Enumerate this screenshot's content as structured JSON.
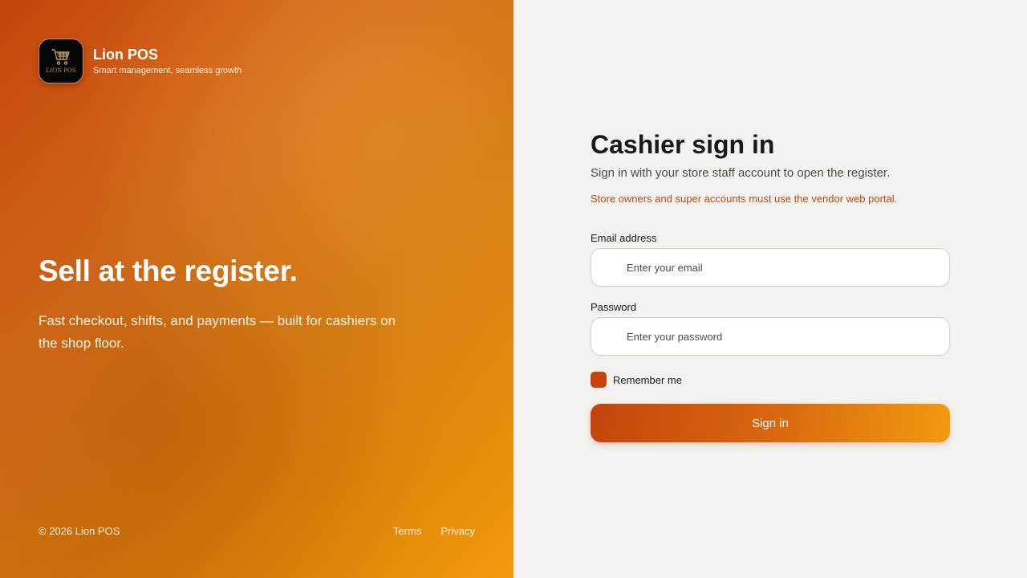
{
  "brand": {
    "name": "Lion POS",
    "tagline": "Smart management, seamless growth",
    "logo_text": "LION POS",
    "logo_icon": "shopping-cart-icon"
  },
  "hero": {
    "title": "Sell at the register.",
    "subtitle": "Fast checkout, shifts, and payments — built for cashiers on the shop floor."
  },
  "footer": {
    "copyright": "© 2026 Lion POS",
    "links": [
      "Terms",
      "Privacy"
    ]
  },
  "signin": {
    "title": "Cashier sign in",
    "subtitle": "Sign in with your store staff account to open the register.",
    "note": "Store owners and super accounts must use the vendor web portal.",
    "email": {
      "label": "Email address",
      "placeholder": "Enter your email",
      "value": "",
      "icon": "mail-icon"
    },
    "password": {
      "label": "Password",
      "placeholder": "Enter your password",
      "value": "",
      "icon": "lock-icon"
    },
    "remember_label": "Remember me",
    "remember_checked": true,
    "button_label": "Sign in"
  },
  "colors": {
    "accent": "#c4440c",
    "accent_end": "#f39a10",
    "note": "#bb4a10",
    "logo_gold": "#b89560",
    "background": "#f3f2ef"
  }
}
